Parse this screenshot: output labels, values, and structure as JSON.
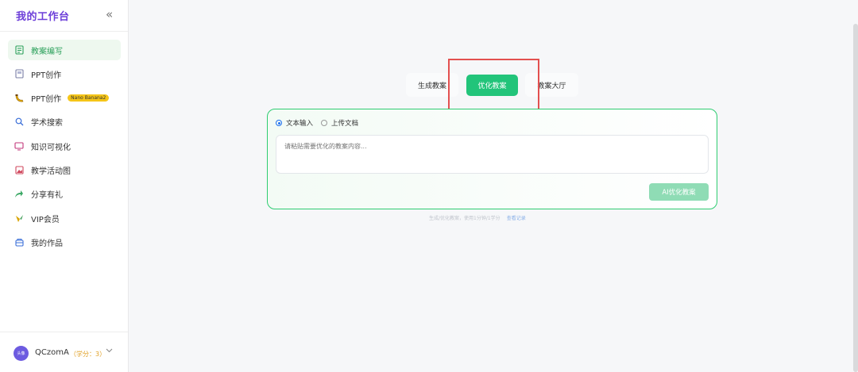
{
  "sidebar": {
    "title": "我的工作台",
    "collapse_icon": "double-chevron-left-icon",
    "items": [
      {
        "label": "教案编写",
        "icon": "document-icon",
        "active": true
      },
      {
        "label": "PPT创作",
        "icon": "slides-icon"
      },
      {
        "label": "PPT创作",
        "icon": "banana-icon",
        "badge": "Nano Banana2"
      },
      {
        "label": "学术搜索",
        "icon": "search-icon"
      },
      {
        "label": "知识可视化",
        "icon": "monitor-icon"
      },
      {
        "label": "教学活动图",
        "icon": "image-icon"
      },
      {
        "label": "分享有礼",
        "icon": "share-arrow-icon"
      },
      {
        "label": "VIP会员",
        "icon": "vip-icon"
      },
      {
        "label": "我的作品",
        "icon": "folder-icon"
      }
    ]
  },
  "user": {
    "avatar_text": "头像",
    "name": "QCzomA",
    "credits": "（学分：3）"
  },
  "tabs": [
    {
      "label": "生成教案"
    },
    {
      "label": "优化教案",
      "active": true
    },
    {
      "label": "教案大厅"
    }
  ],
  "input_mode": {
    "options": [
      "文本输入",
      "上传文档"
    ],
    "selected": "文本输入"
  },
  "editor": {
    "placeholder": "请粘贴需要优化的教案内容..."
  },
  "submit_label": "AI优化教案",
  "footnote": {
    "text": "生成/优化教案，使用1分钟/1学分",
    "link": "查看记录"
  },
  "colors": {
    "accent": "#22c47a",
    "brand_title": "#6d3fd9",
    "highlight": "#e35050"
  }
}
